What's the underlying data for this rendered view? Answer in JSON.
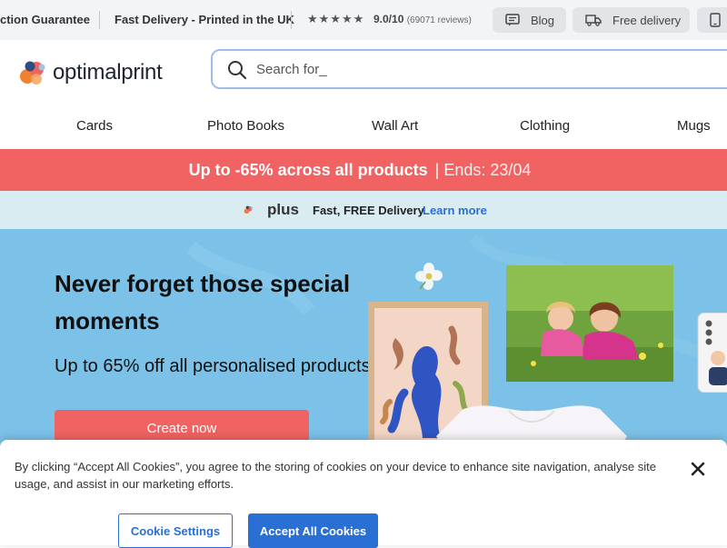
{
  "topbar": {
    "guarantee": "ction Guarantee",
    "delivery_uk": "Fast Delivery - Printed in the UK",
    "stars_icon": "star-rating-icon",
    "rating_score": "9.0/10",
    "rating_reviews": "(69071 reviews)",
    "blog_label": "Blog",
    "free_delivery_label": "Free delivery"
  },
  "header": {
    "logo_text": "optimalprint",
    "search_placeholder": "Search for_"
  },
  "nav": {
    "items": [
      "Cards",
      "Photo Books",
      "Wall Art",
      "Clothing",
      "Mugs"
    ]
  },
  "promo": {
    "main": "Up to -65% across all products",
    "ends": "| Ends: 23/04"
  },
  "plus": {
    "word": "plus",
    "text": "Fast, FREE Delivery",
    "link": "Learn more"
  },
  "hero": {
    "title": "Never forget those special moments",
    "subtitle": "Up to 65% off all personalised products",
    "cta": "Create now"
  },
  "cookie": {
    "text": "By clicking “Accept All Cookies”, you agree to the storing of cookies on your device to enhance site navigation, analyse site usage, and assist in our marketing efforts.",
    "settings_label": "Cookie Settings",
    "accept_label": "Accept All Cookies"
  },
  "colors": {
    "accent_red": "#f06362",
    "link_blue": "#2a6fd4",
    "hero_blue": "#7cc2e8",
    "plus_band": "#d9ecf2"
  }
}
